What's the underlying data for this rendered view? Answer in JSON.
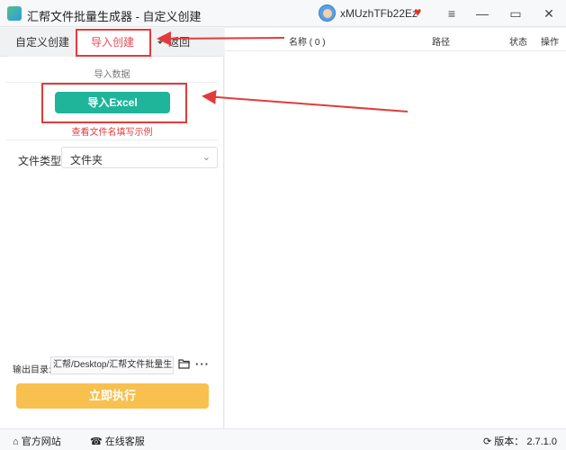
{
  "window": {
    "title": "汇帮文件批量生成器 - 自定义创建",
    "username": "xMUzhTFb22Ez",
    "icons": {
      "menu": "hamburger-icon",
      "minimize": "minimize-icon",
      "maximize": "maximize-icon",
      "close": "close-icon",
      "vip": "vip-heart-icon"
    }
  },
  "tabs": {
    "custom": "自定义创建",
    "import": "导入创建",
    "back": "返回"
  },
  "import_section": {
    "label": "导入数据",
    "button": "导入Excel",
    "example_link": "查看文件名填写示例"
  },
  "file_type": {
    "label": "文件类型",
    "value": "文件夹"
  },
  "output": {
    "label": "输出目录:",
    "path": "汇帮/Desktop/汇帮文件批量生成器"
  },
  "execute_button": "立即执行",
  "table": {
    "columns": [
      "名称 ( 0 )",
      "路径",
      "状态",
      "操作"
    ],
    "rows": []
  },
  "statusbar": {
    "website": "官方网站",
    "service": "在线客服",
    "version": "版本： 2.7.1.0"
  },
  "colors": {
    "accent_green": "#1fb59b",
    "execute_orange": "#f8c04e",
    "annotation_red": "#e23b3b",
    "active_tab_text": "#e74c5b"
  }
}
